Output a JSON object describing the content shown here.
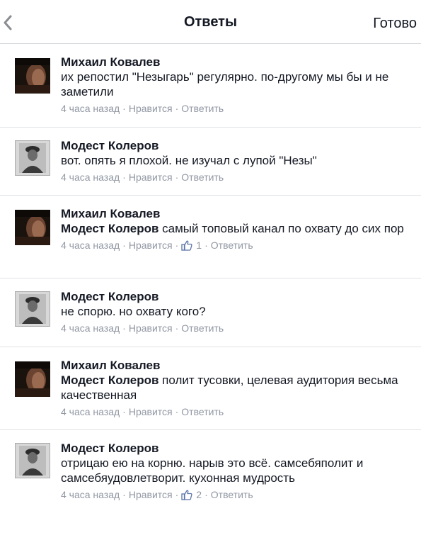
{
  "nav": {
    "title": "Ответы",
    "done_label": "Готово"
  },
  "colors": {
    "meta": "#9197a3",
    "like_icon": "#5b74a8",
    "divider": "#e1e2e5"
  },
  "comments": [
    {
      "author": "Михаил Ковалев",
      "mention": "",
      "text": "их репостил \"Незыгарь\" регулярно. по-другому мы бы и не заметили",
      "time": "4 часа назад",
      "like_label": "Нравится",
      "likes": "",
      "reply_label": "Ответить"
    },
    {
      "author": "Модест Колеров",
      "mention": "",
      "text": "вот. опять я плохой. не изучал с лупой \"Незы\"",
      "time": "4 часа назад",
      "like_label": "Нравится",
      "likes": "",
      "reply_label": "Ответить"
    },
    {
      "author": "Михаил Ковалев",
      "mention": "Модест Колеров",
      "text": " самый топовый канал по охвату до сих пор",
      "time": "4 часа назад",
      "like_label": "Нравится",
      "likes": "1",
      "reply_label": "Ответить"
    },
    {
      "author": "Модест Колеров",
      "mention": "",
      "text": "не спорю. но охвату кого?",
      "time": "4 часа назад",
      "like_label": "Нравится",
      "likes": "",
      "reply_label": "Ответить"
    },
    {
      "author": "Михаил Ковалев",
      "mention": "Модест Колеров",
      "text": " полит тусовки, целевая аудитория весьма качественная",
      "time": "4 часа назад",
      "like_label": "Нравится",
      "likes": "",
      "reply_label": "Ответить"
    },
    {
      "author": "Модест Колеров",
      "mention": "",
      "text": "отрицаю ею на корню. нарыв это всё. самсебяполит и самсебяудовлетворит. кухонная мудрость",
      "time": "4 часа назад",
      "like_label": "Нравится",
      "likes": "2",
      "reply_label": "Ответить"
    }
  ]
}
